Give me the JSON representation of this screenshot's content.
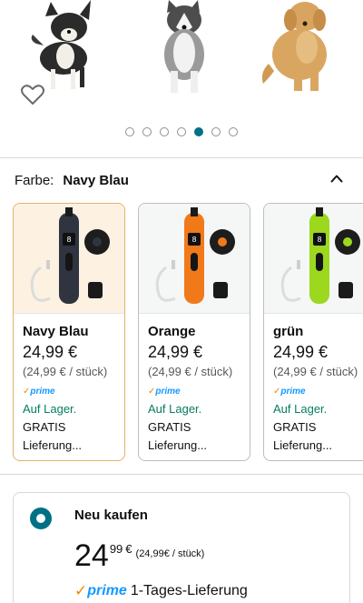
{
  "gallery": {
    "dots_total": 7,
    "active_dot_index": 4,
    "icons": {
      "favorite": "heart-outline-icon"
    }
  },
  "color_selector": {
    "label": "Farbe:",
    "selected_value": "Navy Blau",
    "toggle_icon": "chevron-up-icon"
  },
  "variants": [
    {
      "name": "Navy Blau",
      "price": "24,99 €",
      "unit_price": "(24,99 € / stück)",
      "prime": "prime",
      "stock": "Auf Lager.",
      "shipping_line1": "GRATIS",
      "shipping_line2": "Lieferung...",
      "body_color": "#2f3440",
      "selected": true
    },
    {
      "name": "Orange",
      "price": "24,99 €",
      "unit_price": "(24,99 € / stück)",
      "prime": "prime",
      "stock": "Auf Lager.",
      "shipping_line1": "GRATIS",
      "shipping_line2": "Lieferung...",
      "body_color": "#f07a1a",
      "selected": false
    },
    {
      "name": "grün",
      "price": "24,99 €",
      "unit_price": "(24,99 € / stück)",
      "prime": "prime",
      "stock": "Auf Lager.",
      "shipping_line1": "GRATIS",
      "shipping_line2": "Lieferung...",
      "body_color": "#9bd81e",
      "selected": false
    }
  ],
  "buy_box": {
    "title": "Neu kaufen",
    "price_whole": "24",
    "price_fraction": "99",
    "price_symbol": "€",
    "unit_price": "(24,99€ / stück)",
    "prime_check": "✓",
    "prime_label": "prime",
    "delivery_text": "1-Tages-Lieferung"
  },
  "colors": {
    "accent_teal": "#007185",
    "prime_blue": "#1399ff",
    "in_stock_green": "#067d62",
    "selected_border": "#e3b26b"
  }
}
